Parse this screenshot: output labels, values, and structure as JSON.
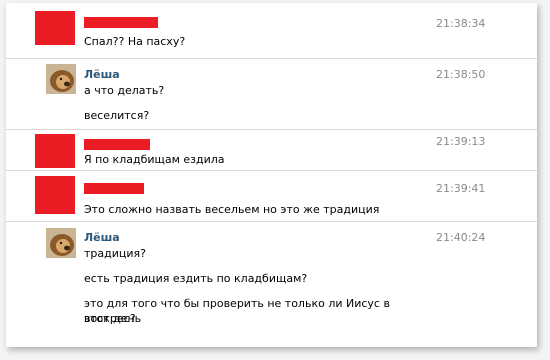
{
  "messages": [
    {
      "sender": "",
      "sender_redacted": true,
      "time": "21:38:34",
      "lines": [
        "Спал?? На пасху?"
      ]
    },
    {
      "sender": "Лёша",
      "sender_redacted": false,
      "time": "21:38:50",
      "lines": [
        "а что делать?",
        "веселится?"
      ]
    },
    {
      "sender": "",
      "sender_redacted": true,
      "time": "21:39:13",
      "lines": [
        "Я по кладбищам ездила"
      ]
    },
    {
      "sender": "",
      "sender_redacted": true,
      "time": "21:39:41",
      "lines": [
        "Это сложно назвать весельем но это же традиция"
      ]
    },
    {
      "sender": "Лёша",
      "sender_redacted": false,
      "time": "21:40:24",
      "lines": [
        "традиция?",
        "есть традиция ездить по кладбищам?",
        "это для того что бы проверить не только ли Иисус в этот день",
        "воскрес?"
      ]
    }
  ],
  "colors": {
    "redaction": "#ec1c24",
    "sender_link": "#2b587a",
    "timestamp": "#8a8a8a"
  },
  "icons": {
    "avatar": "lion-avatar-icon"
  }
}
